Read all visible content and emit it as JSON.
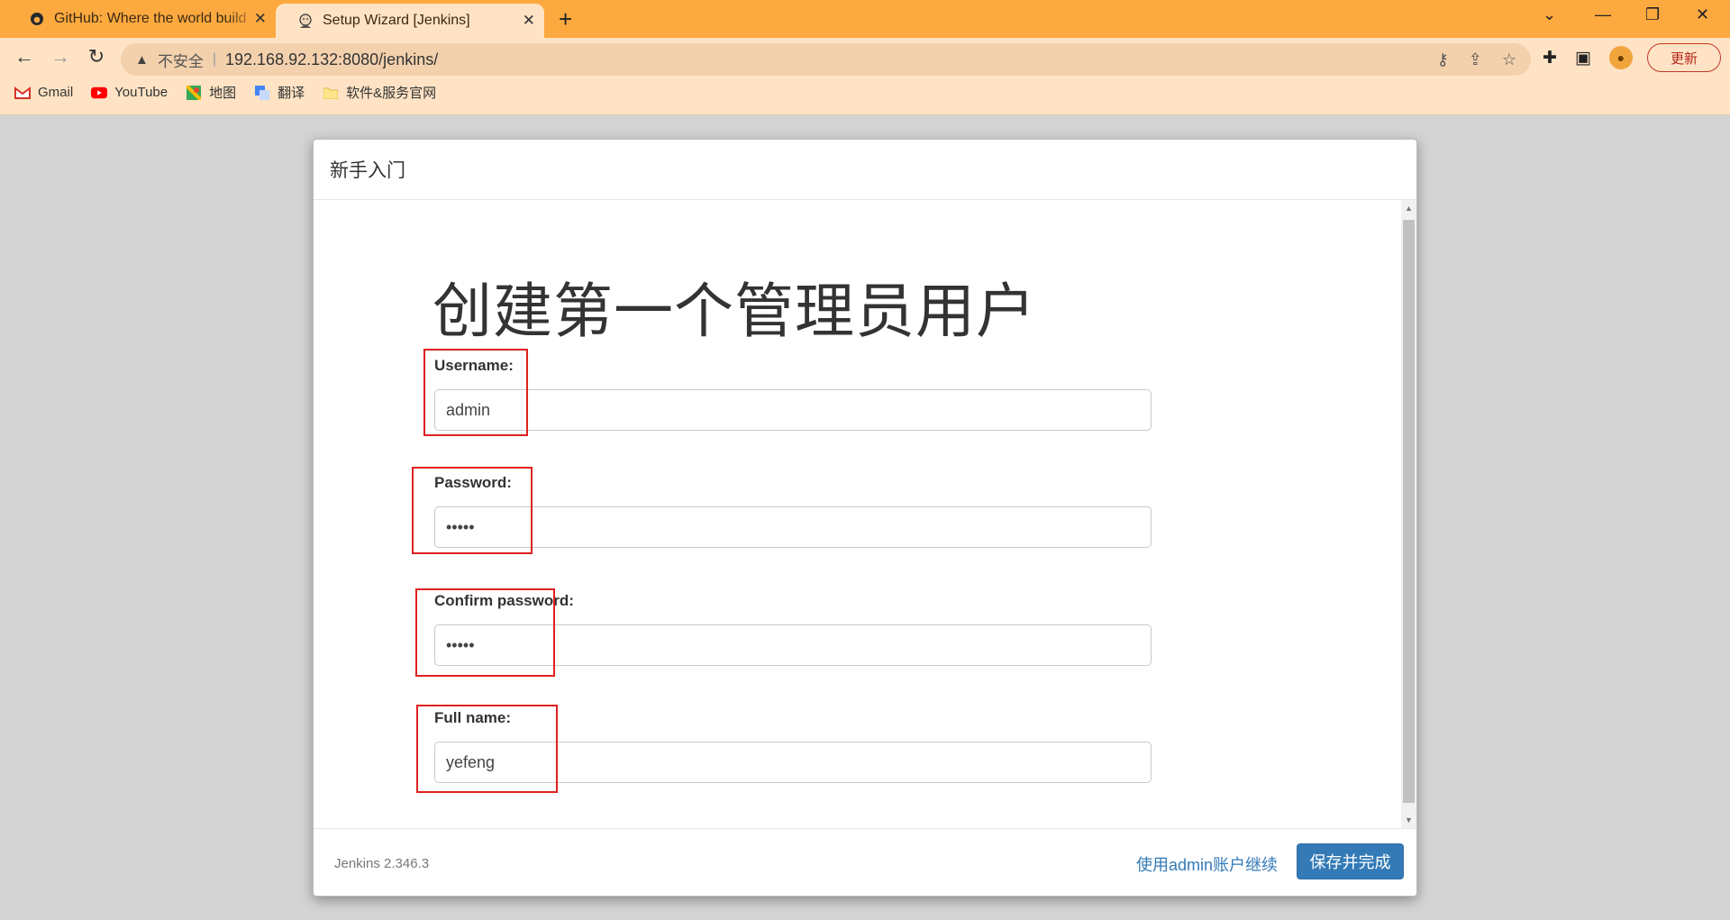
{
  "browser": {
    "tabs": [
      {
        "title": "GitHub: Where the world build",
        "icon": "github-icon"
      },
      {
        "title": "Setup Wizard [Jenkins]",
        "icon": "jenkins-icon"
      }
    ],
    "address": {
      "security_label": "不安全",
      "url": "192.168.92.132:8080/jenkins/"
    },
    "update_label": "更新",
    "bookmarks": [
      {
        "label": "Gmail",
        "icon": "gmail-icon"
      },
      {
        "label": "YouTube",
        "icon": "youtube-icon"
      },
      {
        "label": "地图",
        "icon": "maps-icon"
      },
      {
        "label": "翻译",
        "icon": "translate-icon"
      },
      {
        "label": "软件&服务官网",
        "icon": "folder-icon"
      }
    ]
  },
  "dialog": {
    "header_title": "新手入门",
    "heading": "创建第一个管理员用户",
    "fields": {
      "username": {
        "label": "Username:",
        "value": "admin"
      },
      "password": {
        "label": "Password:",
        "value": "•••••"
      },
      "confirm_password": {
        "label": "Confirm password:",
        "value": "•••••"
      },
      "full_name": {
        "label": "Full name:",
        "value": "yefeng"
      }
    },
    "footer": {
      "version": "Jenkins 2.346.3",
      "continue_link": "使用admin账户继续",
      "save_button": "保存并完成"
    }
  },
  "colors": {
    "tab_bar": "#fca93f",
    "toolbar": "#ffe3c4",
    "primary_button": "#337ab7",
    "highlight_box": "#e02020"
  }
}
